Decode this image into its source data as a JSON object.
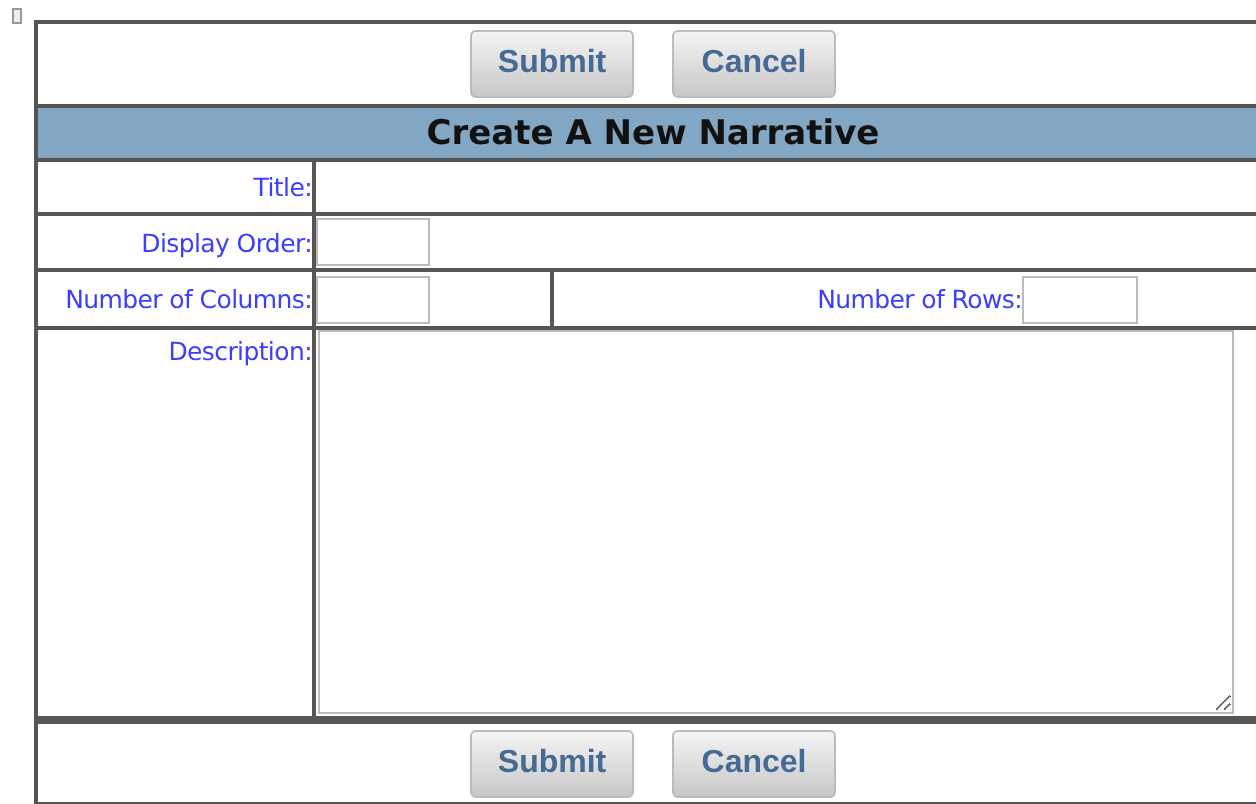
{
  "top_buttons": [
    "Submit",
    "Cancel"
  ],
  "heading": "Create A New Narrative",
  "fields": {
    "title": {
      "label": "Title:"
    },
    "display_order": {
      "label": "Display Order:"
    },
    "columns": {
      "label": "Number of Columns:"
    },
    "rows": {
      "label": "Number of Rows:"
    },
    "description": {
      "label": "Description:"
    }
  },
  "bottom_buttons": [
    "Submit",
    "Cancel"
  ]
}
